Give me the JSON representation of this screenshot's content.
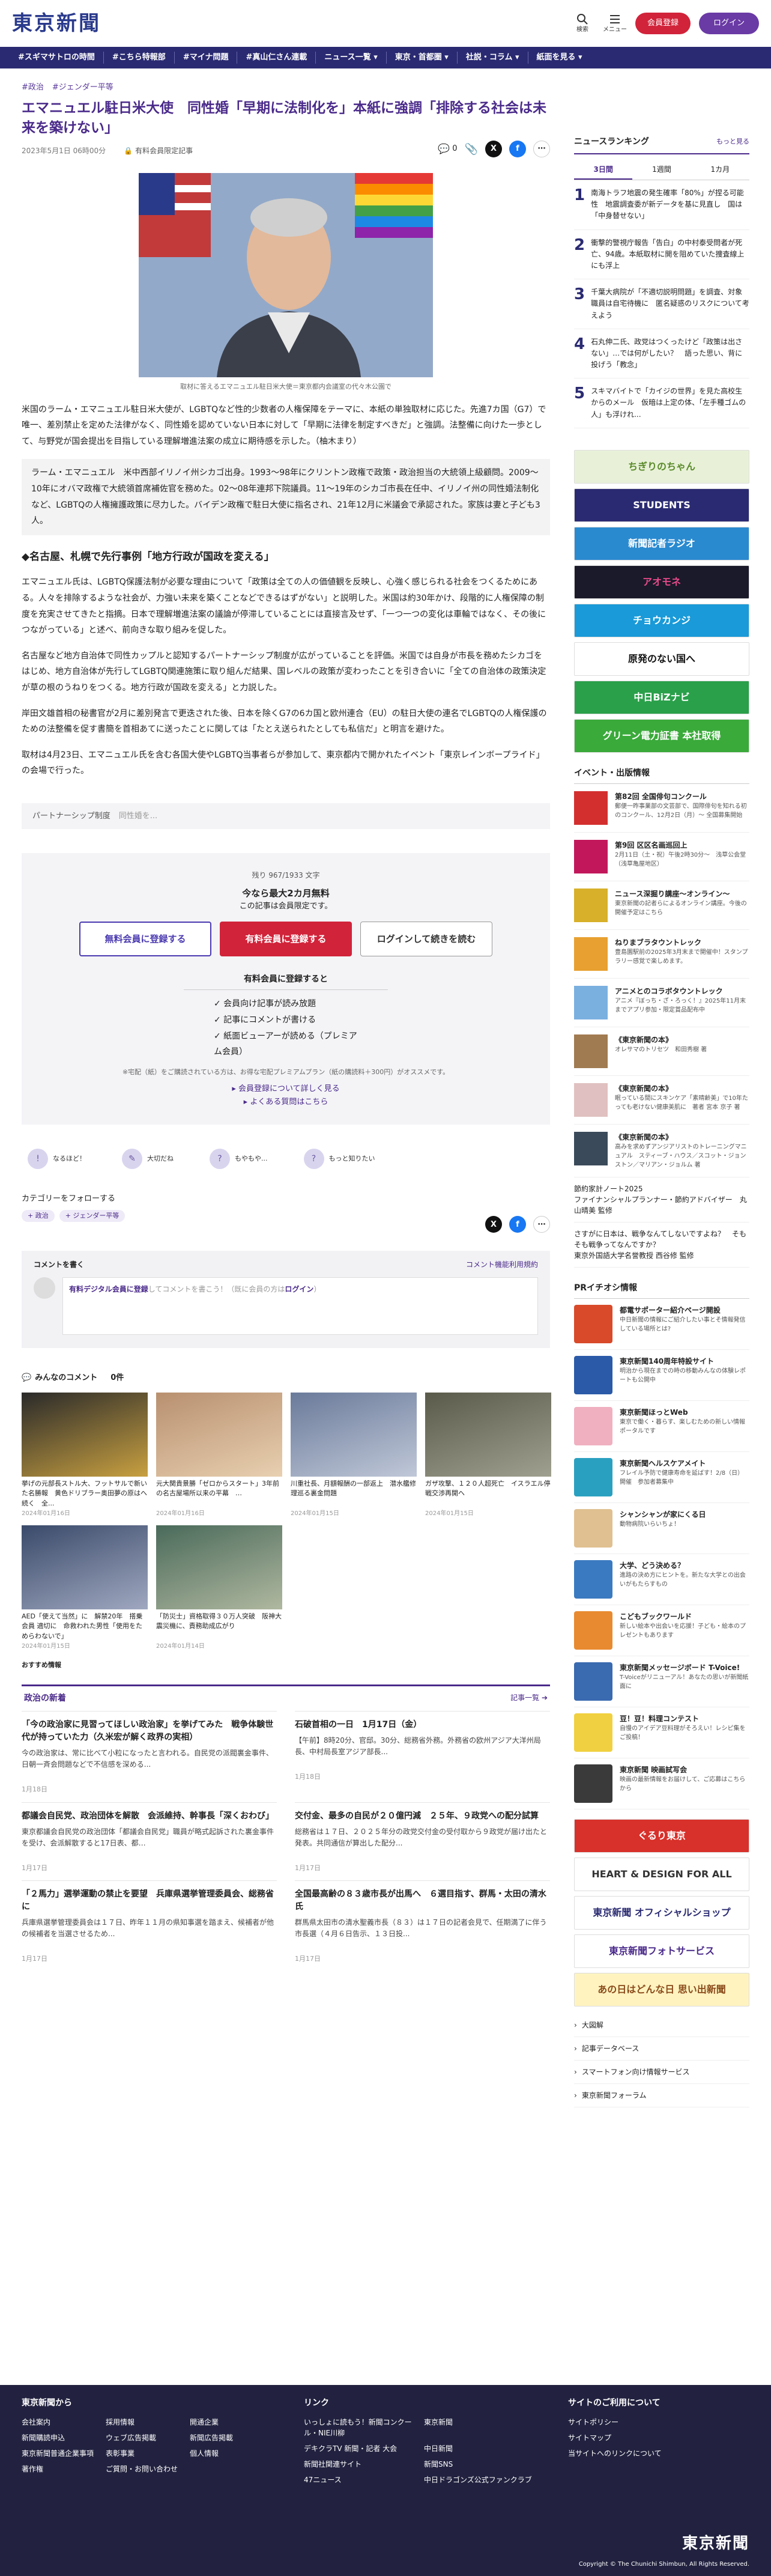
{
  "header": {
    "logo": "東京新聞",
    "search": "検索",
    "menu": "メニュー",
    "register": "会員登録",
    "login": "ログイン"
  },
  "nav": [
    "#スギマサトロの時間",
    "#こちら特報部",
    "#マイナ問題",
    "#真山仁さん連載",
    "ニュース一覧 ▾",
    "東京・首都圏 ▾",
    "社説・コラム ▾",
    "紙面を見る ▾"
  ],
  "article": {
    "tags": [
      "#政治",
      "#ジェンダー平等"
    ],
    "title": "エマニュエル駐日米大使　同性婚「早期に法制化を」本紙に強調「排除する社会は未来を築けない」",
    "date": "2023年5月1日 06時00分",
    "member_label": "有料会員限定記事",
    "comment_count": "0",
    "caption": "取材に答えるエマニュエル駐日米大使＝東京都内会議室の代々木公園で",
    "p1": "米国のラーム・エマニュエル駐日米大使が、LGBTQなど性的少数者の人権保障をテーマに、本紙の単独取材に応じた。先進7カ国（G7）で唯一、差別禁止を定めた法律がなく、同性婚を認めていない日本に対して「早期に法律を制定すべきだ」と強調。法整備に向けた一歩として、与野党が国会提出を目指している理解増進法案の成立に期待感を示した。（柚木まり）",
    "profile": "ラーム・エマニュエル　米中西部イリノイ州シカゴ出身。1993〜98年にクリントン政権で政策・政治担当の大統領上級顧問。2009〜10年にオバマ政権で大統領首席補佐官を務めた。02〜08年連邦下院議員。11〜19年のシカゴ市長在任中、イリノイ州の同性婚法制化など、LGBTQの人権擁護政策に尽力した。バイデン政権で駐日大使に指名され、21年12月に米議会で承認された。家族は妻と子ども3人。",
    "h2": "◆名古屋、札幌で先行事例「地方行政が国政を変える」",
    "p2": "エマニュエル氏は、LGBTQ保護法制が必要な理由について「政策は全ての人の価値観を反映し、心強く感じられる社会をつくるためにある。人々を排除するような社会が、力強い未来を築くことなどできるはずがない」と説明した。米国は約30年かけ、段階的に人権保障の制度を充実させてきたと指摘。日本で理解増進法案の議論が停滞していることには直接言及せず、「一つ一つの変化は車輪ではなく、その後につながっている」と述べ、前向きな取り組みを促した。",
    "p3": "名古屋など地方自治体で同性カップルと認知するパートナーシップ制度が広がっていることを評価。米国では自身が市長を務めたシカゴをはじめ、地方自治体が先行してLGBTQ関連施策に取り組んだ結果、国レベルの政策が変わったことを引き合いに「全ての自治体の政策決定が草の根のうねりをつくる。地方行政が国政を変える」と力説した。",
    "p4": "岸田文雄首相の秘書官が2月に差別発言で更迭された後、日本を除くG7の6カ国と欧州連合（EU）の駐日大使の連名でLGBTQの人権保護のための法整備を促す書簡を首相あてに送ったことに関しては「たとえ送られたとしても私信だ」と明言を避けた。",
    "p5": "取材は4月23日、エマニュエル氏を含む各国大使やLGBTQ当事者らが参加して、東京都内で開かれたイベント「東京レインボープライド」の会場で行った。",
    "related_label": "パートナーシップ制度",
    "related_text": "同性婚を..."
  },
  "paywall": {
    "remaining": "残り 967/1933 文字",
    "promo": "今なら最大2カ月無料",
    "note": "この記事は会員限定です。",
    "btn_free": "無料会員に登録する",
    "btn_paid": "有料会員に登録する",
    "btn_login": "ログインして続きを読む",
    "benefit_head": "有料会員に登録すると",
    "benefits": [
      "✓ 会員向け記事が読み放題",
      "✓ 記事にコメントが書ける",
      "✓ 紙面ビューアーが読める（プレミアム会員）"
    ],
    "footnote": "※宅配（紙）をご購読されている方は、お得な宅配プレミアムプラン（紙の購読料＋300円）がオススメです。",
    "link1": "▸ 会員登録について詳しく見る",
    "link2": "▸ よくある質問はこちら"
  },
  "reactions": [
    {
      "icon": "!",
      "label": "なるほど！"
    },
    {
      "icon": "✎",
      "label": "大切だね"
    },
    {
      "icon": "?",
      "label": "もやもや..."
    },
    {
      "icon": "?",
      "label": "もっと知りたい"
    }
  ],
  "follow": {
    "label": "カテゴリーをフォローする",
    "chips": [
      "+ 政治",
      "+ ジェンダー平等"
    ]
  },
  "comment": {
    "title": "コメントを書く",
    "policy": "コメント機能利用規約",
    "placeholder_lead": "有料デジタル会員に登録",
    "placeholder_mid": "してコメントを書こう！（既に会員の方は",
    "placeholder_login": "ログイン",
    "placeholder_end": "）"
  },
  "everyone": {
    "title": "みんなのコメント",
    "count": "0件"
  },
  "thumbs": [
    {
      "t": "挙げの元部長ストル大、フットサルで新いた名勝報　黄色ドリブラー奥田夢の原はへ続く　全...",
      "d": "2024年01月16日",
      "c": "#c8a040"
    },
    {
      "t": "元大関貴景勝「ゼロからスタート」3年前の名古屋場所以来の平幕　…",
      "d": "2024年01月16日",
      "c": "#d8b88a"
    },
    {
      "t": "川重社長、月額報酬の一部返上　潜水艦修理巡る裏金問題",
      "d": "2024年01月15日",
      "c": "#aabbcc"
    },
    {
      "t": "ガザ攻撃、１２０人超死亡　イスラエル停戦交渉再開へ",
      "d": "2024年01月15日",
      "c": "#8a8a7a"
    },
    {
      "t": "AED「使えて当然」に　解禁20年　搭乗会員 適切に　命救われた男性「使用をためらわないで」",
      "d": "2024年01月15日",
      "c": "#7a8aa0"
    },
    {
      "t": "「防災士」資格取得３０万人突破　阪神大震災機に、責務助成広がり",
      "d": "2024年01月14日",
      "c": "#5a7a9a"
    }
  ],
  "recommend": "おすすめ情報",
  "politics": {
    "title": "政治の新着",
    "more": "記事一覧 ➔",
    "items": [
      {
        "t": "「今の政治家に見習ってほしい政治家」を挙げてみた　戦争体験世代が持っていた力（久米宏が解く政界の実相）",
        "x": "今の政治家は、常に比べて小粒になったと言われる。自民党の派閥裏金事件、日朝一斉会問題などで不信感を深める...",
        "d": "1月18日"
      },
      {
        "t": "石破首相の一日　1月17日（金）",
        "x": "【午前】8時20分、官邸。30分、総務省外務。外務省の欧州アジア大洋州局長、中村局長室アジア部長...",
        "d": "1月18日"
      },
      {
        "t": "都議会自民党、政治団体を解散　会派維持、幹事長「深くおわび」",
        "x": "東京都議会自民党の政治団体「都議会自民党」職員が略式起訴された裏金事件を受け、会派解散すると17日表、都…",
        "d": "1月17日"
      },
      {
        "t": "交付金、最多の自民が２０億円減　２５年、９政党への配分試算",
        "x": "総務省は１７日、２０２５年分の政党交付金の受付取から９政党が届け出たと発表。共同通信が算出した配分...",
        "d": "1月17日"
      },
      {
        "t": "「２馬力」選挙運動の禁止を要望　兵庫県選挙管理委員会、総務省に",
        "x": "兵庫県選挙管理委員会は１７日、昨年１１月の県知事選を踏まえ、候補者が他の候補者を当選させるため...",
        "d": "1月17日"
      },
      {
        "t": "全国最高齢の８３歳市長が出馬へ　６選目指す、群馬・太田の清水氏",
        "x": "群馬県太田市の清水聖義市長（８３）は１７日の記者会見で、任期満了に伴う市長選（４月６日告示、１３日投...",
        "d": "1月17日"
      }
    ]
  },
  "ranking": {
    "title": "ニュースランキング",
    "more": "もっと見る",
    "tabs": [
      "3日間",
      "1週間",
      "1カ月"
    ],
    "items": [
      "南海トラフ地震の発生確率「80%」が捏る可能性　地震調査委が新データを基に見直し　国は「中身替せない」",
      "衝撃的警視庁報告「告白」の中村泰受問者が死亡、94歳。本紙取材に開を阻めていた捜査線上にも浮上",
      "千葉大病院が「不適切説明問題」を調査、対象職員は自宅待機に　匿名疑惑のリスクについて考えよう",
      "石丸伸二氏、政党はつくったけど「政策は出さない」…では何がしたい？　語った思い、背に投げう「教念」",
      "スキマバイトで「カイジの世界」を見た高校生からのメール　仮暗は上定の体、「左手種ゴムの人」も浮けれ..."
    ]
  },
  "banners": [
    {
      "label": "ちぎりのちゃん",
      "c": "#e8f1d8",
      "fc": "#5a8a2a"
    },
    {
      "label": "STUDENTS",
      "c": "#2a2a72",
      "fc": "#fff"
    },
    {
      "label": "新聞記者ラジオ",
      "c": "#2a8ad0",
      "fc": "#fff"
    },
    {
      "label": "アオモネ",
      "c": "#1a1a2a",
      "fc": "#e84a8a"
    },
    {
      "label": "チョウカンジ",
      "c": "#1a9ad8",
      "fc": "#fff"
    },
    {
      "label": "原発のない国へ",
      "c": "#fff",
      "fc": "#111"
    },
    {
      "label": "中日BiZナビ",
      "c": "#2aa04a",
      "fc": "#fff"
    },
    {
      "label": "グリーン電力証書 本社取得",
      "c": "#3aaa3a",
      "fc": "#fff"
    }
  ],
  "events": {
    "title": "イベント・出版情報",
    "items": [
      {
        "t": "第82回 全国俳句コンクール",
        "d": "郵便一昨事業部の文芸部で、国際俳句を知れる初のコンクール、12月2日（月）～ 全国募集開始",
        "c": "#d32f2f"
      },
      {
        "t": "第9回 区区名画巡回上",
        "d": "2月11日（土・祝）午後2時30分～　浅草公会堂（浅草亀屋地区）",
        "c": "#c2185b"
      },
      {
        "t": "ニュース深掘り講座〜オンライン〜",
        "d": "東京新聞の記者らによるオンライン講座。今後の開催予定はこちら",
        "c": "#d8b02a"
      },
      {
        "t": "ねりまブラタウントレック",
        "d": "豊島園駅前の2025年3月末まで開催中！スタンプラリー感覚で楽しめます。",
        "c": "#e8a030"
      },
      {
        "t": "アニメとのコラボタウントレック",
        "d": "アニメ『ぼっち・ざ・ろっく！』2025年11月末までアプリ参加・限定賞品配布中",
        "c": "#7ab0e0"
      },
      {
        "t": "《東京新聞の本》",
        "d": "オレサマのトリセツ　和田秀樹 著",
        "c": "#a07a50"
      },
      {
        "t": "《東京新聞の本》",
        "d": "眠っている間にスキンケア「素晴齢美」で10年たっても老けない健康美肌に　著者 宮本 京子 著",
        "c": "#e0c0c0"
      },
      {
        "t": "《東京新聞の本》",
        "d": "高みを求めずアンジアリストのトレーニングマニュアル　スティーブ・ハウス／スコット・ジョンストン／マリアン・ジョルム 著",
        "c": "#3a4a5a"
      }
    ],
    "links": [
      "節約家計ノート2025\nファイナンシャルプランナー・節約アドバイザー　丸山晴美 監修",
      "さすがに日本は、戦争なんてしないですよね？　そもそも戦争ってなんですか？\n東京外国語大学名誉教授 西谷修 監修"
    ]
  },
  "pr": {
    "title": "PRイチオシ情報",
    "items": [
      {
        "t": "都電サポーター紹介ページ開設",
        "d": "中日新聞の情報にご紹介したい事とそ情報発信している場所とは?",
        "c": "#d84a2a"
      },
      {
        "t": "東京新聞140周年特設サイト",
        "d": "明治から現在までの時の移動みんなの体験レポートも公開中",
        "c": "#2a5aa8"
      },
      {
        "t": "東京新聞ほっとWeb",
        "d": "東京で働く・暮らす、楽しむための新しい情報ポータルです",
        "c": "#f0b0c0"
      },
      {
        "t": "東京新聞ヘルスケアメイト",
        "d": "フレイル予防で健康寿命を延ばす！2/8（日）開催　参加者募集中",
        "c": "#2aa0c0"
      },
      {
        "t": "シャンシャンが家にくる日",
        "d": "動物病院いらいちょ！",
        "c": "#e0c090"
      },
      {
        "t": "大学、どう決める？",
        "d": "進路の決め方にヒントを。新たな大学との出会いがもたらすもの",
        "c": "#3a7ac0"
      },
      {
        "t": "こどもブックワールド",
        "d": "新しい絵本や出会いを応援！子ども・絵本のプレゼントもあります",
        "c": "#e88a30"
      },
      {
        "t": "東京新聞メッセージボード T-Voice!",
        "d": "T-Voiceがリニューアル！あなたの思いが新聞紙面に",
        "c": "#3a6ab0"
      },
      {
        "t": "豆！豆！料理コンテスト",
        "d": "自慢のアイデア豆料理がそろえい！レシピ集をご投稿！",
        "c": "#f0d040"
      },
      {
        "t": "東京新聞 映画試写会",
        "d": "映画の最新情報をお届けして、ご応募はこちらから",
        "c": "#3a3a3a"
      }
    ]
  },
  "side_banners2": [
    {
      "label": "ぐるり東京",
      "c": "#d8302a",
      "fc": "#fff"
    },
    {
      "label": "HEART & DESIGN FOR ALL",
      "c": "#fff",
      "fc": "#333"
    },
    {
      "label": "東京新聞 オフィシャルショップ",
      "c": "#fff",
      "fc": "#2a2a72"
    },
    {
      "label": "東京新聞フォトサービス",
      "c": "#fff",
      "fc": "#4a2a8a"
    },
    {
      "label": "あの日はどんな日 思い出新聞",
      "c": "#fff4c0",
      "fc": "#8a4a1a"
    }
  ],
  "side_links": [
    "大図解",
    "記事データベース",
    "スマートフォン向け情報サービス",
    "東京新聞フォーラム"
  ],
  "footer": {
    "col1_title": "東京新聞から",
    "col1": [
      "会社案内",
      "採用情報",
      "開通企業",
      "新聞購読申込",
      "ウェブ広告掲載",
      "新聞広告掲載",
      "東京新聞普通企業事項",
      "表彰事業",
      "個人情報",
      "著作権",
      "ご質問・お問い合わせ"
    ],
    "col2_title": "リンク",
    "col2": [
      "いっしょに読もう！新聞コンクール・NIE川柳",
      "東京新聞",
      "デキクラTV 新聞・記者 大会",
      "中日新聞",
      "新聞社関連サイト",
      "新聞SNS",
      "47ニュース",
      "中日ドラゴンズ公式ファンクラブ"
    ],
    "col3_title": "サイトのご利用について",
    "col3": [
      "サイトポリシー",
      "サイトマップ",
      "当サイトへのリンクについて"
    ],
    "logo": "東京新聞",
    "copy": "Copyright © The Chunichi Shimbun, All Rights Reserved."
  }
}
